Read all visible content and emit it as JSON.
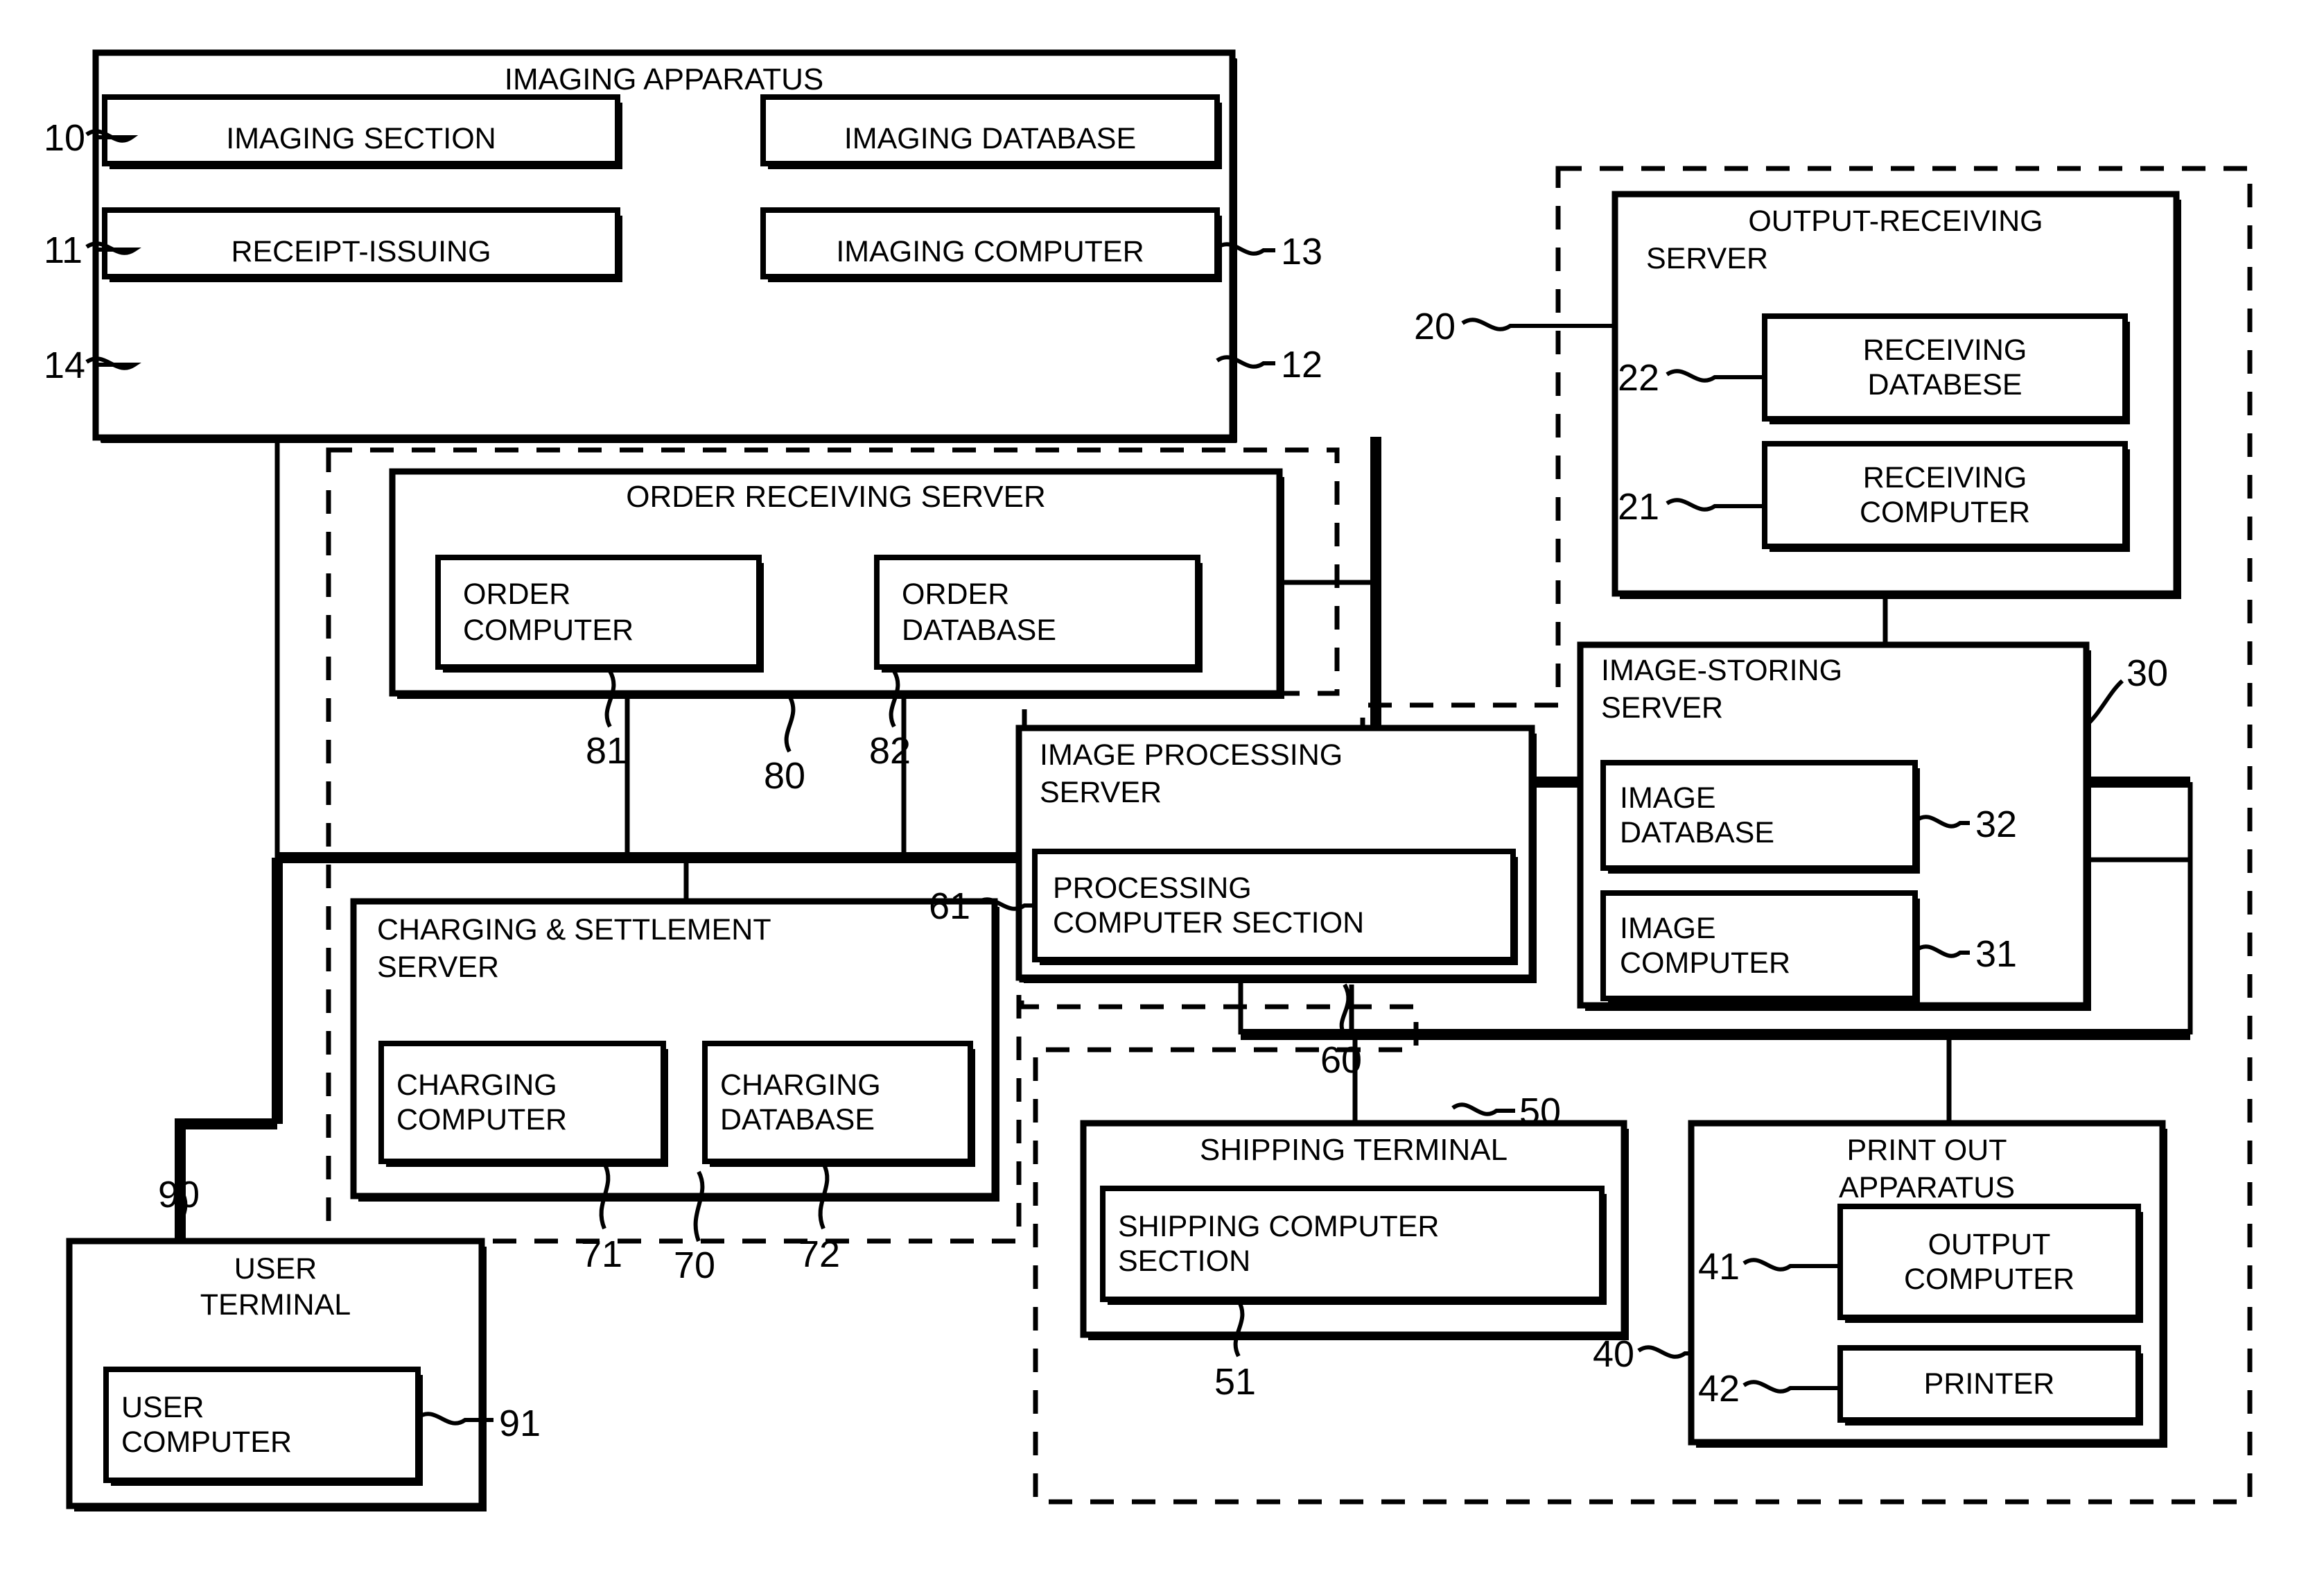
{
  "figure": {
    "kind": "patent-block-diagram",
    "blocks": {
      "imaging_apparatus": {
        "title": "IMAGING APPARATUS",
        "ref": "10",
        "children": [
          {
            "label": "IMAGING SECTION",
            "ref": "11"
          },
          {
            "label": "IMAGING DATABASE",
            "ref": "13"
          },
          {
            "label": "RECEIPT-ISSUING",
            "ref": "14"
          },
          {
            "label": "IMAGING COMPUTER",
            "ref": "12"
          }
        ]
      },
      "output_receiving_server": {
        "title_line1": "OUTPUT-RECEIVING",
        "title_line2": "SERVER",
        "ref": "20",
        "children": [
          {
            "line1": "RECEIVING",
            "line2": "DATABESE",
            "ref": "22"
          },
          {
            "line1": "RECEIVING",
            "line2": "COMPUTER",
            "ref": "21"
          }
        ]
      },
      "order_receiving_server": {
        "title": "ORDER RECEIVING SERVER",
        "ref": "80",
        "children": [
          {
            "line1": "ORDER",
            "line2": "COMPUTER",
            "ref": "81"
          },
          {
            "line1": "ORDER",
            "line2": "DATABASE",
            "ref": "82"
          }
        ]
      },
      "image_processing_server": {
        "title_line1": "IMAGE PROCESSING",
        "title_line2": "SERVER",
        "ref": "60",
        "children": [
          {
            "line1": "PROCESSING",
            "line2": "COMPUTER SECTION",
            "ref": "61"
          }
        ]
      },
      "image_storing_server": {
        "title_line1": "IMAGE-STORING",
        "title_line2": "SERVER",
        "ref": "30",
        "children": [
          {
            "line1": "IMAGE",
            "line2": "DATABASE",
            "ref": "32"
          },
          {
            "line1": "IMAGE",
            "line2": "COMPUTER",
            "ref": "31"
          }
        ]
      },
      "charging_settlement_server": {
        "title_line1": "CHARGING & SETTLEMENT",
        "title_line2": "SERVER",
        "ref": "70",
        "children": [
          {
            "line1": "CHARGING",
            "line2": "COMPUTER",
            "ref": "71"
          },
          {
            "line1": "CHARGING",
            "line2": "DATABASE",
            "ref": "72"
          }
        ]
      },
      "shipping_terminal": {
        "title": "SHIPPING TERMINAL",
        "ref": "50",
        "children": [
          {
            "line1": "SHIPPING COMPUTER",
            "line2": "SECTION",
            "ref": "51"
          }
        ]
      },
      "print_out_apparatus": {
        "title_line1": "PRINT OUT",
        "title_line2": "APPARATUS",
        "ref": "40",
        "children": [
          {
            "line1": "OUTPUT",
            "line2": "COMPUTER",
            "ref": "41"
          },
          {
            "line1": "PRINTER",
            "line2": "",
            "ref": "42"
          }
        ]
      },
      "user_terminal": {
        "title_line1": "USER",
        "title_line2": "TERMINAL",
        "ref": "90",
        "children": [
          {
            "line1": "USER",
            "line2": "COMPUTER",
            "ref": "91"
          }
        ]
      }
    },
    "reference_numerals": [
      "10",
      "11",
      "12",
      "13",
      "14",
      "20",
      "21",
      "22",
      "30",
      "31",
      "32",
      "40",
      "41",
      "42",
      "50",
      "51",
      "60",
      "61",
      "70",
      "71",
      "72",
      "80",
      "81",
      "82",
      "90",
      "91"
    ],
    "colors": {
      "ink": "#000000",
      "paper": "#ffffff"
    }
  }
}
